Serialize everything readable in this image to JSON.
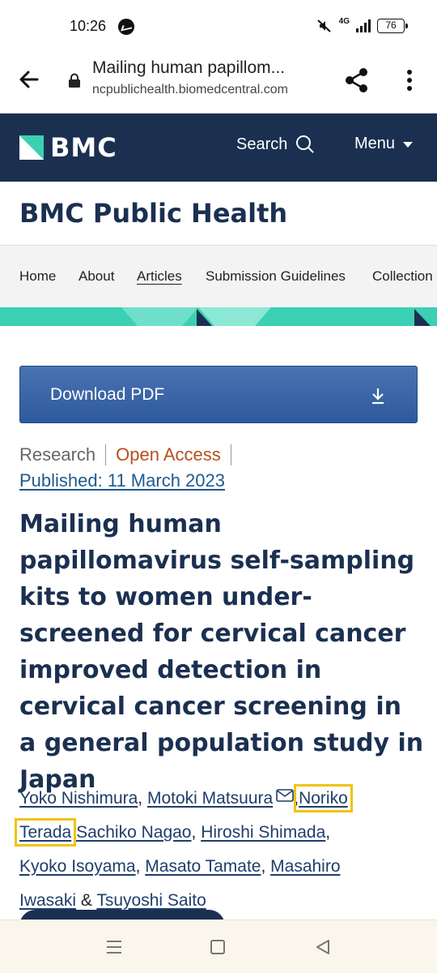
{
  "status_bar": {
    "time": "10:26",
    "network": "4G",
    "battery": "76"
  },
  "browser": {
    "page_title": "Mailing human papillom...",
    "domain": "ncpublichealth.biomedcentral.com"
  },
  "site_header": {
    "logo_text": "BMC",
    "search_label": "Search",
    "menu_label": "Menu"
  },
  "journal": {
    "title": "BMC Public Health"
  },
  "nav": {
    "items": [
      {
        "label": "Home"
      },
      {
        "label": "About"
      },
      {
        "label": "Articles"
      },
      {
        "label": "Submission Guidelines"
      },
      {
        "label": "Collection"
      }
    ]
  },
  "article": {
    "download_label": "Download PDF",
    "type": "Research",
    "access": "Open Access",
    "published": "Published: 11 March 2023",
    "title": "Mailing human papillomavirus self-sampling kits to women under-screened for cervical cancer improved detection in cervical cancer screening in a general population study in Japan",
    "authors": [
      "Yoko Nishimura",
      "Motoki Matsuura",
      "Noriko",
      "Terada",
      "Sachiko Nagao",
      "Hiroshi Shimada",
      "Kyoko Isoyama",
      "Masato Tamate",
      "Masahiro",
      "Iwasaki",
      "Tsuyoshi Saito"
    ],
    "separator_comma": ",",
    "separator_and": "&"
  },
  "colors": {
    "header_bg": "#1b3051",
    "accent_teal": "#3bd0b4",
    "pdf_button": "#2d5a9e",
    "open_access": "#b5501f",
    "highlight": "#f0c30f"
  }
}
